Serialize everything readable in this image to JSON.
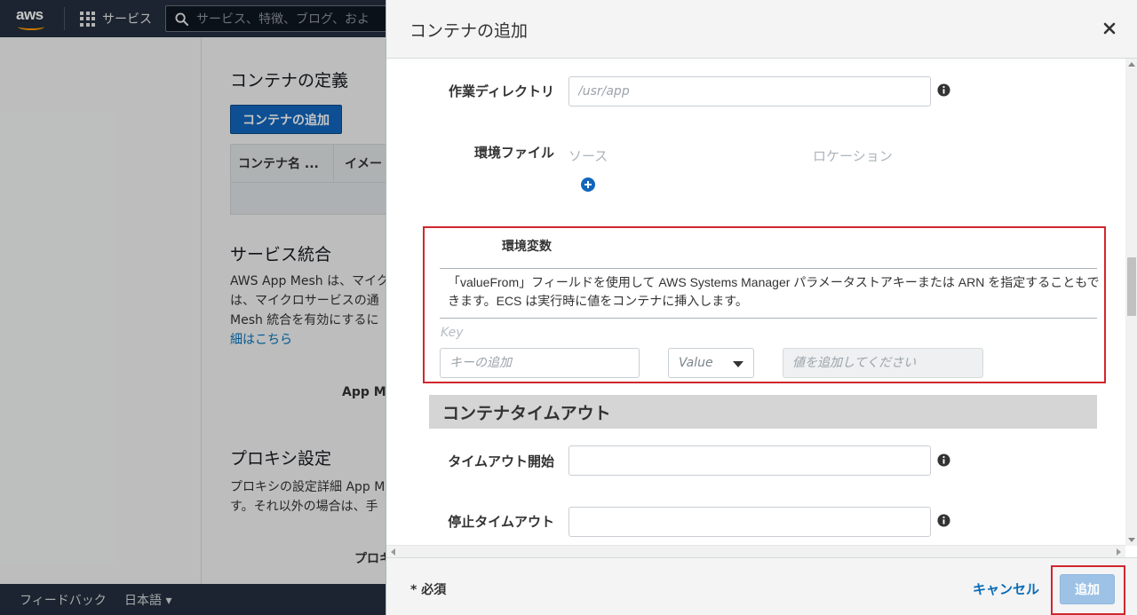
{
  "topnav": {
    "logo_text": "aws",
    "services_label": "サービス",
    "search_placeholder": "サービス、特徴、ブログ、およ"
  },
  "background": {
    "container_def_title": "コンテナの定義",
    "add_container_button": "コンテナの追加",
    "table_headers": [
      "コンテナ名 ...",
      "イメー"
    ],
    "service_integration_title": "サービス統合",
    "service_integration_text": [
      "AWS App Mesh は、マイク",
      "は、マイクロサービスの通",
      "Mesh 統合を有効にするに"
    ],
    "service_integration_link": "細はこちら",
    "app_mesh_label": "App Me",
    "proxy_title": "プロキシ設定",
    "proxy_text": [
      "プロキシの設定詳細 App M",
      "す。それ以外の場合は、手"
    ],
    "proxy_label": "プロキ"
  },
  "footer": {
    "feedback": "フィードバック",
    "language": "日本語"
  },
  "modal": {
    "title": "コンテナの追加",
    "working_dir": {
      "label": "作業ディレクトリ",
      "placeholder": "/usr/app"
    },
    "env_file": {
      "label": "環境ファイル",
      "col_source": "ソース",
      "col_location": "ロケーション"
    },
    "env_vars": {
      "title": "環境変数",
      "description": "「valueFrom」フィールドを使用して AWS Systems Manager パラメータストアキーまたは ARN を指定することもできます。ECS は実行時に値をコンテナに挿入します。",
      "key_label": "Key",
      "key_placeholder": "キーの追加",
      "value_type": "Value",
      "value_placeholder": "値を追加してください"
    },
    "timeout_section": {
      "title": "コンテナタイムアウト",
      "start_label": "タイムアウト開始",
      "stop_label": "停止タイムアウト"
    },
    "footer": {
      "required_note": "* 必須",
      "cancel": "キャンセル",
      "add": "追加"
    }
  },
  "colors": {
    "nav_bg": "#232f3e",
    "primary_button": "#1166bb",
    "link": "#0a6bb5",
    "highlight_border": "#d0272d",
    "disabled_add": "#9ec2e6"
  }
}
